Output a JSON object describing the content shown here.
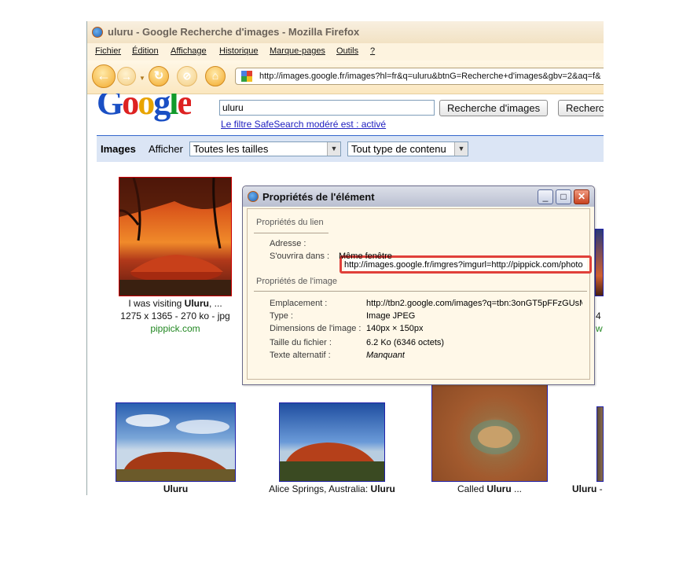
{
  "browser": {
    "title": "uluru - Google Recherche d'images - Mozilla Firefox",
    "menu": [
      "Fichier",
      "Édition",
      "Affichage",
      "Historique",
      "Marque-pages",
      "Outils",
      "?"
    ],
    "url": "http://images.google.fr/images?hl=fr&q=uluru&btnG=Recherche+d'images&gbv=2&aq=f&"
  },
  "google": {
    "logo": "Google",
    "search_value": "uluru",
    "search_button": "Recherche d'images",
    "search_button2": "Recherc",
    "safesearch": "Le filtre SafeSearch modéré est : activé",
    "images_label": "Images",
    "afficher_label": "Afficher",
    "size_select": "Toutes les tailles",
    "type_select": "Tout type de contenu"
  },
  "results_row1": [
    {
      "caption_pre": "I was visiting ",
      "caption_bold": "Uluru",
      "caption_post": ", ...",
      "meta": "1275 x 1365 - 270 ko - jpg",
      "site": "pippick.com"
    }
  ],
  "results_row1_partial": {
    "meta_fragment": "4",
    "site_fragment": "w"
  },
  "results_row2": [
    {
      "caption_pre": "",
      "caption_bold": "Uluru",
      "caption_post": ""
    },
    {
      "caption_pre": "Alice Springs, Australia: ",
      "caption_bold": "Uluru",
      "caption_post": ""
    },
    {
      "caption_pre": "Called ",
      "caption_bold": "Uluru",
      "caption_post": " ..."
    },
    {
      "caption_pre": "",
      "caption_bold": "Uluru",
      "caption_post": " -"
    }
  ],
  "dialog": {
    "title": "Propriétés de l'élément",
    "link_section": "Propriétés du lien",
    "address_label": "Adresse :",
    "address_value": "http://images.google.fr/imgres?imgurl=http://pippick.com/photo",
    "opens_label": "S'ouvrira dans :",
    "opens_value": "Même fenêtre",
    "image_section": "Propriétés de l'image",
    "rows": [
      {
        "label": "Emplacement :",
        "value": "http://tbn2.google.com/images?q=tbn:3onGT5pFFzGUsM"
      },
      {
        "label": "Type :",
        "value": "Image JPEG"
      },
      {
        "label": "Dimensions de l'image :",
        "value": "140px × 150px"
      },
      {
        "label": "Taille du fichier :",
        "value": "6.2 Ko (6346 octets)"
      },
      {
        "label": "Texte alternatif :",
        "value": "Manquant"
      }
    ],
    "highlight_color": "#e0403a"
  }
}
